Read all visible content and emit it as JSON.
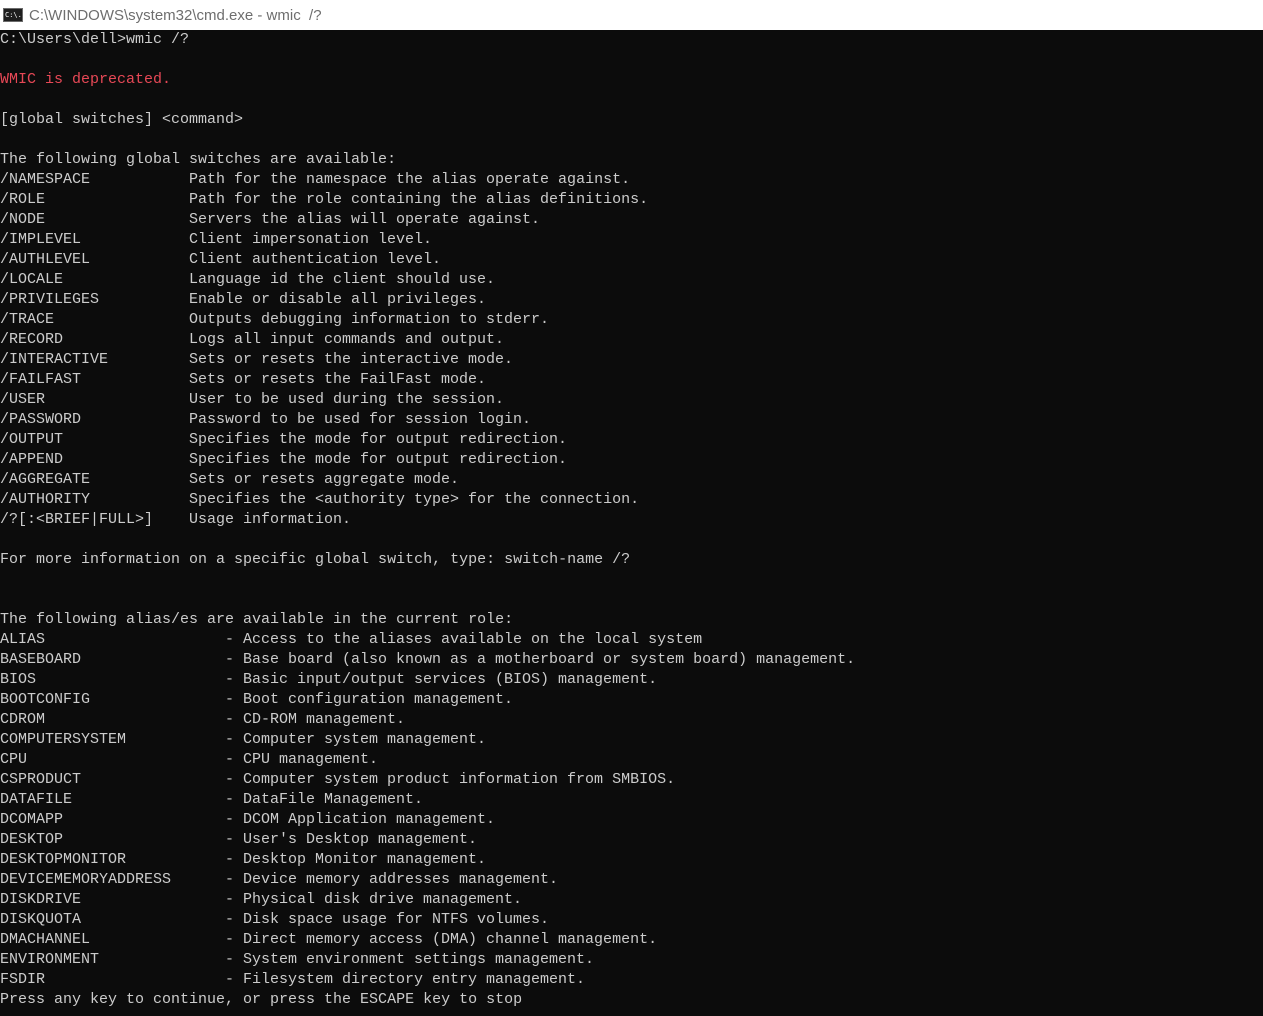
{
  "window": {
    "title": "C:\\WINDOWS\\system32\\cmd.exe - wmic  /?",
    "icon": "cmd-icon",
    "icon_glyph": "C:\\."
  },
  "console": {
    "prompt": "C:\\Users\\dell>wmic /?",
    "warning": "WMIC is deprecated.",
    "usage": "[global switches] <command>",
    "switches_header": "The following global switches are available:",
    "switches": [
      {
        "name": "/NAMESPACE",
        "desc": "Path for the namespace the alias operate against."
      },
      {
        "name": "/ROLE",
        "desc": "Path for the role containing the alias definitions."
      },
      {
        "name": "/NODE",
        "desc": "Servers the alias will operate against."
      },
      {
        "name": "/IMPLEVEL",
        "desc": "Client impersonation level."
      },
      {
        "name": "/AUTHLEVEL",
        "desc": "Client authentication level."
      },
      {
        "name": "/LOCALE",
        "desc": "Language id the client should use."
      },
      {
        "name": "/PRIVILEGES",
        "desc": "Enable or disable all privileges."
      },
      {
        "name": "/TRACE",
        "desc": "Outputs debugging information to stderr."
      },
      {
        "name": "/RECORD",
        "desc": "Logs all input commands and output."
      },
      {
        "name": "/INTERACTIVE",
        "desc": "Sets or resets the interactive mode."
      },
      {
        "name": "/FAILFAST",
        "desc": "Sets or resets the FailFast mode."
      },
      {
        "name": "/USER",
        "desc": "User to be used during the session."
      },
      {
        "name": "/PASSWORD",
        "desc": "Password to be used for session login."
      },
      {
        "name": "/OUTPUT",
        "desc": "Specifies the mode for output redirection."
      },
      {
        "name": "/APPEND",
        "desc": "Specifies the mode for output redirection."
      },
      {
        "name": "/AGGREGATE",
        "desc": "Sets or resets aggregate mode."
      },
      {
        "name": "/AUTHORITY",
        "desc": "Specifies the <authority type> for the connection."
      },
      {
        "name": "/?[:<BRIEF|FULL>]",
        "desc": "Usage information."
      }
    ],
    "switch_help": "For more information on a specific global switch, type: switch-name /?",
    "aliases_header": "The following alias/es are available in the current role:",
    "aliases": [
      {
        "name": "ALIAS",
        "desc": "- Access to the aliases available on the local system"
      },
      {
        "name": "BASEBOARD",
        "desc": "- Base board (also known as a motherboard or system board) management."
      },
      {
        "name": "BIOS",
        "desc": "- Basic input/output services (BIOS) management."
      },
      {
        "name": "BOOTCONFIG",
        "desc": "- Boot configuration management."
      },
      {
        "name": "CDROM",
        "desc": "- CD-ROM management."
      },
      {
        "name": "COMPUTERSYSTEM",
        "desc": "- Computer system management."
      },
      {
        "name": "CPU",
        "desc": "- CPU management."
      },
      {
        "name": "CSPRODUCT",
        "desc": "- Computer system product information from SMBIOS."
      },
      {
        "name": "DATAFILE",
        "desc": "- DataFile Management."
      },
      {
        "name": "DCOMAPP",
        "desc": "- DCOM Application management."
      },
      {
        "name": "DESKTOP",
        "desc": "- User's Desktop management."
      },
      {
        "name": "DESKTOPMONITOR",
        "desc": "- Desktop Monitor management."
      },
      {
        "name": "DEVICEMEMORYADDRESS",
        "desc": "- Device memory addresses management."
      },
      {
        "name": "DISKDRIVE",
        "desc": "- Physical disk drive management."
      },
      {
        "name": "DISKQUOTA",
        "desc": "- Disk space usage for NTFS volumes."
      },
      {
        "name": "DMACHANNEL",
        "desc": "- Direct memory access (DMA) channel management."
      },
      {
        "name": "ENVIRONMENT",
        "desc": "- System environment settings management."
      },
      {
        "name": "FSDIR",
        "desc": "- Filesystem directory entry management."
      }
    ],
    "pager": "Press any key to continue, or press the ESCAPE key to stop"
  },
  "colors": {
    "background": "#0c0c0c",
    "text": "#cccccc",
    "warning": "#e74856"
  }
}
